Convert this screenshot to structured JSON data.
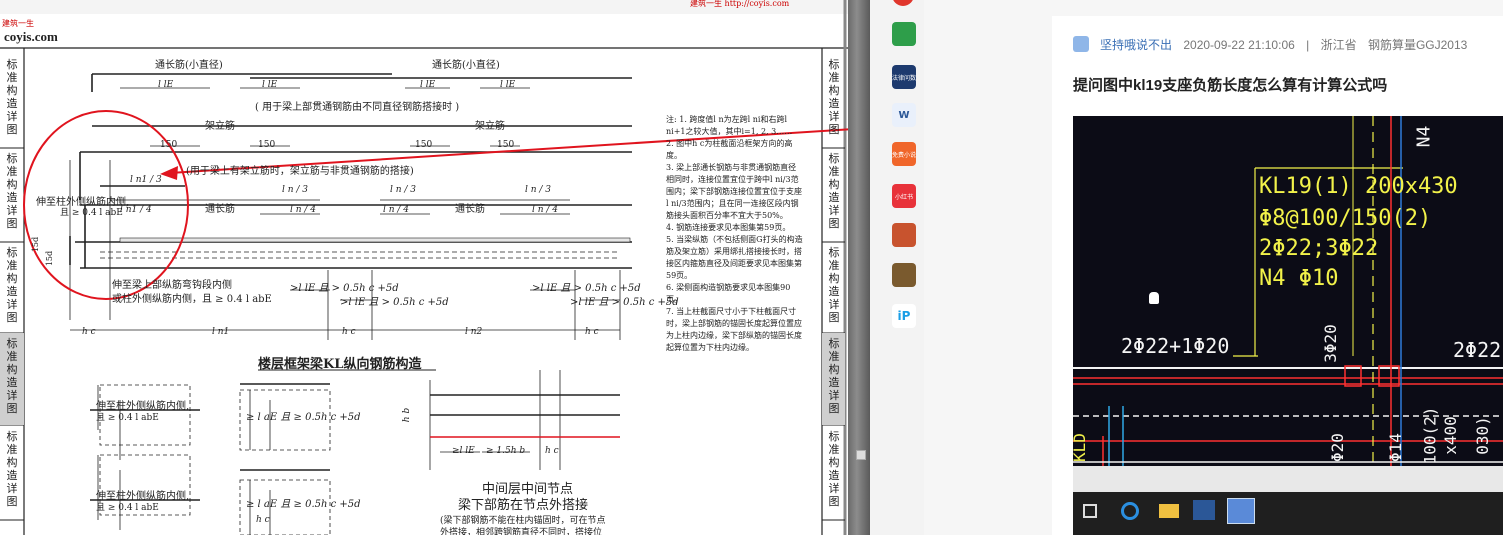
{
  "document": {
    "header_brand_small": "建筑一生",
    "header_brand": "coyis.com",
    "header_watermark": "建筑一生 http://coyis.com",
    "side_label": "标准构造详图",
    "top_labels": {
      "through_bar_left": "通长筋(小直径)",
      "through_bar_right": "通长筋(小直径)",
      "lle1": "l lE",
      "lle2": "l lE",
      "lle3": "l lE",
      "lle4": "l lE",
      "note_splice": "( 用于梁上部贯通钢筋由不同直径钢筋搭接时 )",
      "erect_left": "架立筋",
      "erect_right": "架立筋",
      "n150a": "150",
      "n150b": "150",
      "n150c": "150",
      "n150d": "150",
      "note_erect": "(用于梁上有架立筋时，架立筋与非贯通钢筋的搭接)"
    },
    "beam_labels": {
      "ln1_3": "l n1 / 3",
      "ln_3a": "l n / 3",
      "ln_3b": "l n / 3",
      "ln_3c": "l n / 3",
      "ln_4a": "l n / 4",
      "ln_4b": "l n / 4",
      "ln_4c": "l n / 4",
      "ln1_4": "l n1 / 4",
      "ext_left_1": "伸至柱外侧纵筋内侧,",
      "ext_left_2": "且 ≥ 0.4 l abE",
      "through_a": "通长筋",
      "through_b": "通长筋",
      "d15": "15d",
      "d15b": "15d",
      "ext_bottom_1": "伸至梁上部纵筋弯钩段内侧",
      "ext_bottom_2": "或柱外侧纵筋内侧，且 ≥ 0.4 l abE",
      "le_a": ">l lE 且 > 0.5h c +5d",
      "le_b": ">l lE 且 > 0.5h c +5d",
      "le_c": ">l lE 且 > 0.5h c +5d",
      "le_d": ">l lE 且 > 0.5h c +5d",
      "hc1": "h c",
      "hc2": "h c",
      "hc3": "h c",
      "ln1": "l n1",
      "ln2": "l n2"
    },
    "main_title": "楼层框架梁KL纵向钢筋构造",
    "lower_labels": {
      "ext_a_1": "伸至柱外侧纵筋内侧,",
      "ext_a_2": "且 ≥ 0.4 l abE",
      "ext_b_1": "伸至柱外侧纵筋内侧,",
      "ext_b_2": "且 ≥ 0.4 l abE",
      "le_a": "≥ l aE 且 ≥ 0.5h c +5d",
      "le_b": "≥ l aE 且 ≥ 0.5h c +5d",
      "hc": "h c",
      "hb": "h b",
      "mid_le": "≥l lE",
      "mid_15": "≥ 1.5h b",
      "mid_hc": "h c",
      "mid_title": "中间层中间节点",
      "mid_subtitle": "梁下部筋在节点外搭接",
      "mid_note": "(梁下部钢筋不能在柱内锚固时，可在节点",
      "mid_note2": "外搭接，相邻跨钢筋直径不同时，搭接位"
    },
    "notes": [
      "注: 1. 跨度值l n为左跨l ni和右跨l ni+1之较大值，其中i=1, 2, 3……",
      "2. 图中h c为柱截面沿框架方向的高度。",
      "3. 梁上部通长钢筋与非贯通钢筋直径相同时，连接位置宜位于跨中l ni/3范围内；梁下部钢筋连接位置宜位于支座l ni/3范围内；且在同一连接区段内钢筋接头面积百分率不宜大于50%。",
      "4. 钢筋连接要求见本图集第59页。",
      "5. 当梁纵筋（不包括侧面G打头的构造筋及架立筋）采用绑扎搭接接长时，搭接区内箍筋直径及间距要求见本图集第59页。",
      "6. 梁侧面构造钢筋要求见本图集90页。",
      "7. 当上柱截面尺寸小于下柱截面尺寸时，梁上部钢筋的锚固长度起算位置应为上柱内边缘，梁下部纵筋的锚固长度起算位置为下柱内边缘。"
    ]
  },
  "taskbar": {
    "icons": [
      {
        "name": "mail-icon",
        "color": "#2e9e4a",
        "label": ""
      },
      {
        "name": "puzzle-app-icon",
        "color": "#1d3a6e",
        "label": "法律问数"
      },
      {
        "name": "word-doc-icon",
        "color": "#e9f0fb",
        "label": "W"
      },
      {
        "name": "free-novel-icon",
        "color": "#f0662a",
        "label": "免费小说"
      },
      {
        "name": "red-book-icon",
        "color": "#e8323a",
        "label": "小红书"
      },
      {
        "name": "game-avatar-icon",
        "color": "#c8532e",
        "label": ""
      },
      {
        "name": "game-castle-icon",
        "color": "#7a5a2e",
        "label": ""
      },
      {
        "name": "p-app-icon",
        "color": "#ffffff",
        "label": "iP"
      }
    ]
  },
  "post": {
    "author": "坚持哦说不出",
    "datetime": "2020-09-22 21:10:06",
    "separator": "|",
    "location": "浙江省",
    "software": "钢筋算量GGJ2013",
    "title": "提问图中kl19支座负筋长度怎么算有计算公式吗"
  },
  "photo": {
    "beam_line1": "KL19(1) 200x430",
    "beam_line2": "Φ8@100/150(2)",
    "beam_line3": "2Φ22;3Φ22",
    "beam_line4": "N4 Φ10",
    "left_rebar": "2Φ22+1Φ20",
    "right_rebar": "2Φ22",
    "vert_rebar": "3Φ20",
    "n4": "N4",
    "vert_a": "Φ20",
    "vert_b": "Φ14",
    "vert_c": "100(2)",
    "vert_d": "x400",
    "vert_e": "030)",
    "left_vert": "KLD",
    "taskbar_icons": [
      "task-view-icon",
      "edge-icon",
      "explorer-icon",
      "word-task-icon",
      "cad-task-icon"
    ]
  },
  "colors": {
    "annotation_red": "#e0141e",
    "cad_yellow": "#f2f24a",
    "cad_red": "#ff3030",
    "link_blue": "#3a6fb5"
  }
}
